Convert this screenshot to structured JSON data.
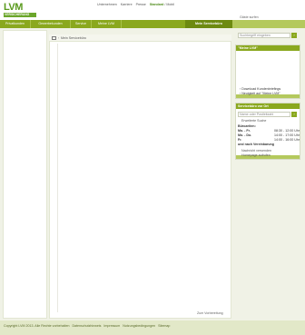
{
  "brand": {
    "logo": "LVM",
    "logo_sub": "VERSICHERUNG"
  },
  "toplinks": [
    {
      "label": "Unternehmen"
    },
    {
      "label": "Karriere"
    },
    {
      "label": "Presse"
    },
    {
      "label": "Standard"
    },
    {
      "label": "Mobil"
    }
  ],
  "toplinks_sep": "/",
  "greeting": "Gäste surfen",
  "nav": [
    {
      "label": "Privatkunden"
    },
    {
      "label": "Gewerbekunden"
    },
    {
      "label": "Service"
    },
    {
      "label": "Meine LVM"
    }
  ],
  "nav_active": "Mein Servicebüro",
  "breadcrumb": {
    "arrow": "›",
    "current": "Mein Servicebüro"
  },
  "back_link": "Zum Vorbereitung",
  "search": {
    "placeholder": "Suchbegriff eingeben",
    "button": "›"
  },
  "meine_lvm": {
    "title": "\"Meine LVM\"",
    "links": [
      {
        "label": "Download Kundenbriefings"
      },
      {
        "label": "Neuigkeit auf \"Meine LVM\""
      }
    ],
    "bullet": "›"
  },
  "office": {
    "title": "Servicebüro vor Ort",
    "plz_placeholder": "Name oder Postleitzahl",
    "button": "›",
    "extended_search": "Erweiterte Suche",
    "hours_title": "Bürozeiten:",
    "hours": [
      {
        "day": "Mo. - Fr.",
        "time": "08:30 - 12:00 Uhr"
      },
      {
        "day": "Mo. - Do.",
        "time": "14:00 - 17:00 Uhr"
      },
      {
        "day": "Fr.",
        "time": "14:00 - 16:00 Uhr"
      }
    ],
    "hours_note": "und nach Vereinbarung",
    "links": [
      {
        "label": "Nachricht versenden"
      },
      {
        "label": "Homepage aufrufen"
      }
    ]
  },
  "footer": {
    "items": [
      {
        "label": "Copyright LVM 2013. Alle Rechte vorbehalten"
      },
      {
        "label": "Datenschutzhinweis"
      },
      {
        "label": "Impressum"
      },
      {
        "label": "Nutzungsbedingungen"
      },
      {
        "label": "Sitemap"
      }
    ]
  }
}
